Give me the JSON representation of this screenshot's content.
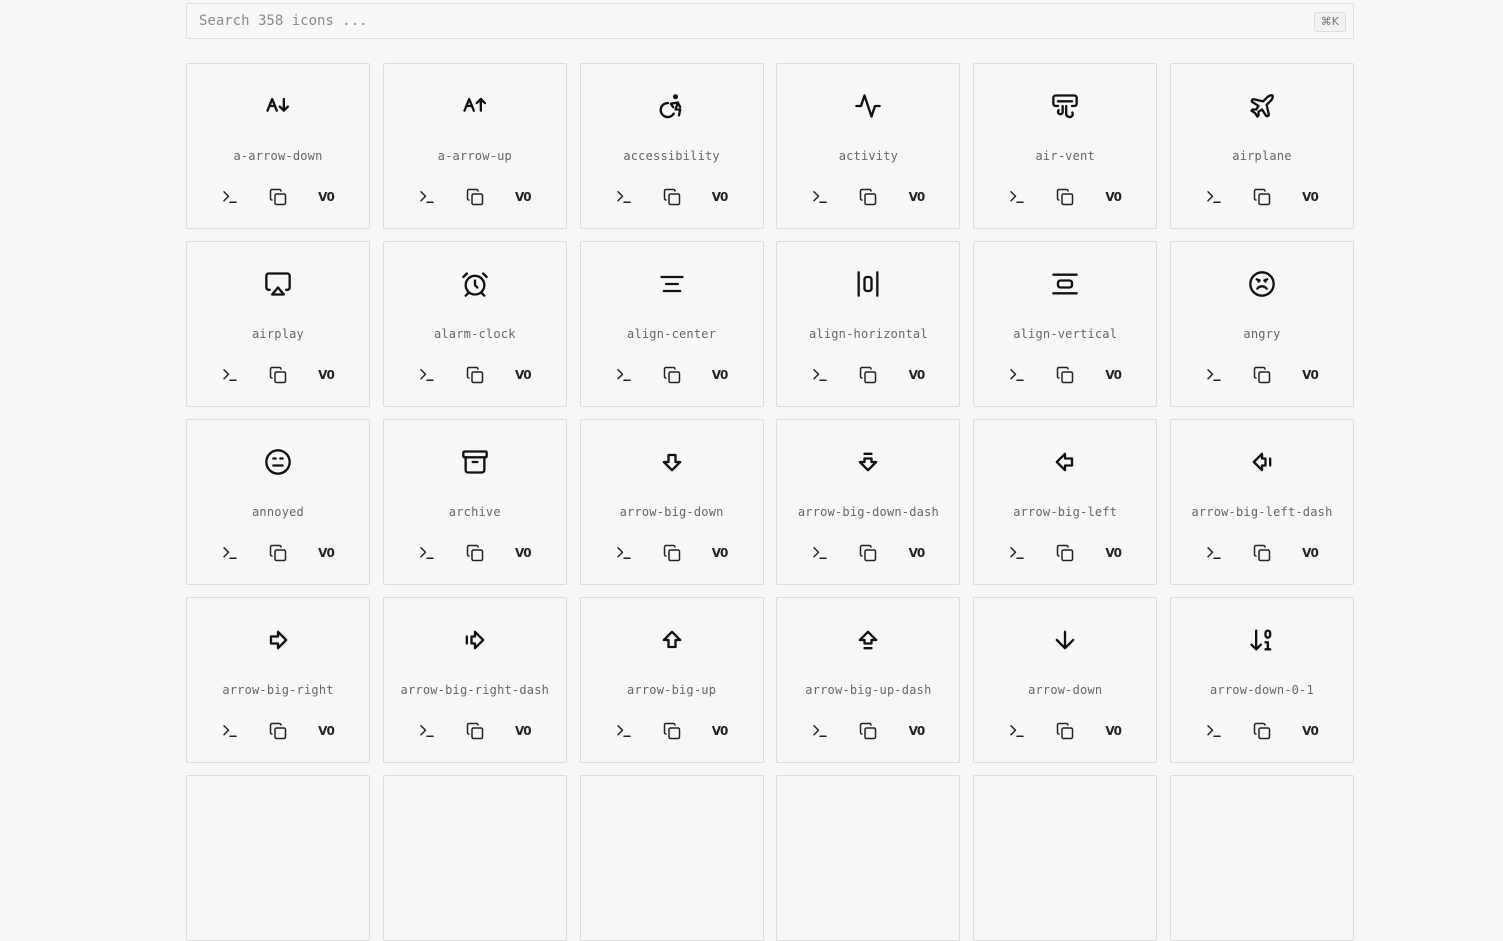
{
  "search": {
    "placeholder": "Search 358 icons ...",
    "shortcut": "⌘K"
  },
  "actions": {
    "terminal_icon": "terminal-icon",
    "copy_icon": "copy-icon",
    "vue_label": "V0"
  },
  "icons": [
    {
      "name": "a-arrow-down",
      "icon": "a-arrow-down-icon"
    },
    {
      "name": "a-arrow-up",
      "icon": "a-arrow-up-icon"
    },
    {
      "name": "accessibility",
      "icon": "accessibility-icon"
    },
    {
      "name": "activity",
      "icon": "activity-icon"
    },
    {
      "name": "air-vent",
      "icon": "air-vent-icon"
    },
    {
      "name": "airplane",
      "icon": "airplane-icon"
    },
    {
      "name": "airplay",
      "icon": "airplay-icon"
    },
    {
      "name": "alarm-clock",
      "icon": "alarm-clock-icon"
    },
    {
      "name": "align-center",
      "icon": "align-center-icon"
    },
    {
      "name": "align-horizontal",
      "icon": "align-horizontal-icon"
    },
    {
      "name": "align-vertical",
      "icon": "align-vertical-icon"
    },
    {
      "name": "angry",
      "icon": "angry-icon"
    },
    {
      "name": "annoyed",
      "icon": "annoyed-icon"
    },
    {
      "name": "archive",
      "icon": "archive-icon"
    },
    {
      "name": "arrow-big-down",
      "icon": "arrow-big-down-icon"
    },
    {
      "name": "arrow-big-down-dash",
      "icon": "arrow-big-down-dash-icon"
    },
    {
      "name": "arrow-big-left",
      "icon": "arrow-big-left-icon"
    },
    {
      "name": "arrow-big-left-dash",
      "icon": "arrow-big-left-dash-icon"
    },
    {
      "name": "arrow-big-right",
      "icon": "arrow-big-right-icon"
    },
    {
      "name": "arrow-big-right-dash",
      "icon": "arrow-big-right-dash-icon"
    },
    {
      "name": "arrow-big-up",
      "icon": "arrow-big-up-icon"
    },
    {
      "name": "arrow-big-up-dash",
      "icon": "arrow-big-up-dash-icon"
    },
    {
      "name": "arrow-down",
      "icon": "arrow-down-icon"
    },
    {
      "name": "arrow-down-0-1",
      "icon": "arrow-down-0-1-icon"
    },
    {
      "name": "",
      "icon": ""
    },
    {
      "name": "",
      "icon": ""
    },
    {
      "name": "",
      "icon": ""
    },
    {
      "name": "",
      "icon": ""
    },
    {
      "name": "",
      "icon": ""
    },
    {
      "name": "",
      "icon": ""
    }
  ]
}
